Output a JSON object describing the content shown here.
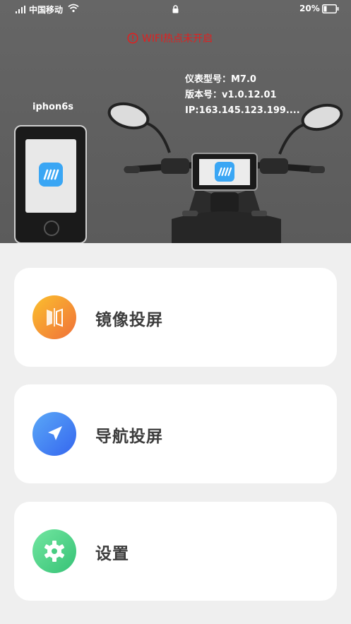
{
  "status_bar": {
    "carrier": "中国移动",
    "battery": "20%"
  },
  "warning": {
    "text": "WIFI热点未开启",
    "color": "#e02020"
  },
  "device": {
    "model": "仪表型号：M7.0",
    "version": "版本号：v1.0.12.01",
    "ip": "IP:163.145.123.199...."
  },
  "phone": {
    "name": "iphon6s"
  },
  "menu": [
    {
      "label": "镜像投屏",
      "icon": "mirror-icon",
      "color_from": "#fbbf2e",
      "color_to": "#f07a38"
    },
    {
      "label": "导航投屏",
      "icon": "navigation-icon",
      "color_from": "#4a9cf5",
      "color_to": "#3a6cf0"
    },
    {
      "label": "设置",
      "icon": "gear-icon",
      "color_from": "#6ee39b",
      "color_to": "#39c67a"
    }
  ],
  "colors": {
    "hero_bg": "#5f5f5f",
    "page_bg": "#efefef",
    "app_logo": "#3aa6f4"
  }
}
